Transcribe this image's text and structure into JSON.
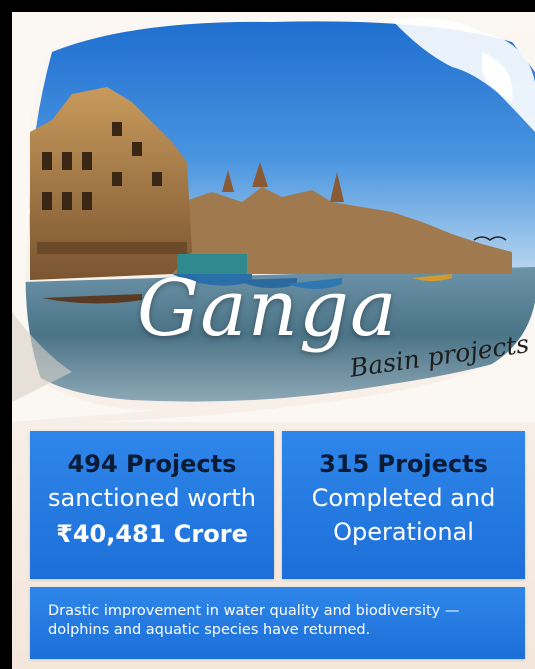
{
  "title": "Ganga",
  "subtitle": "Basin projects",
  "stats": [
    {
      "headline": "494 Projects",
      "line1": "sanctioned worth",
      "line2": "₹40,481 Crore"
    },
    {
      "headline": "315 Projects",
      "line1": "Completed and",
      "line2": "Operational"
    }
  ],
  "note": "Drastic improvement in water quality and biodiversity — dolphins and aquatic species have returned.",
  "colors": {
    "box_blue": "#1c6fd8",
    "headline_dark": "#0a1b36",
    "sky": "#2f7fd3",
    "river": "#4d7f9a"
  }
}
